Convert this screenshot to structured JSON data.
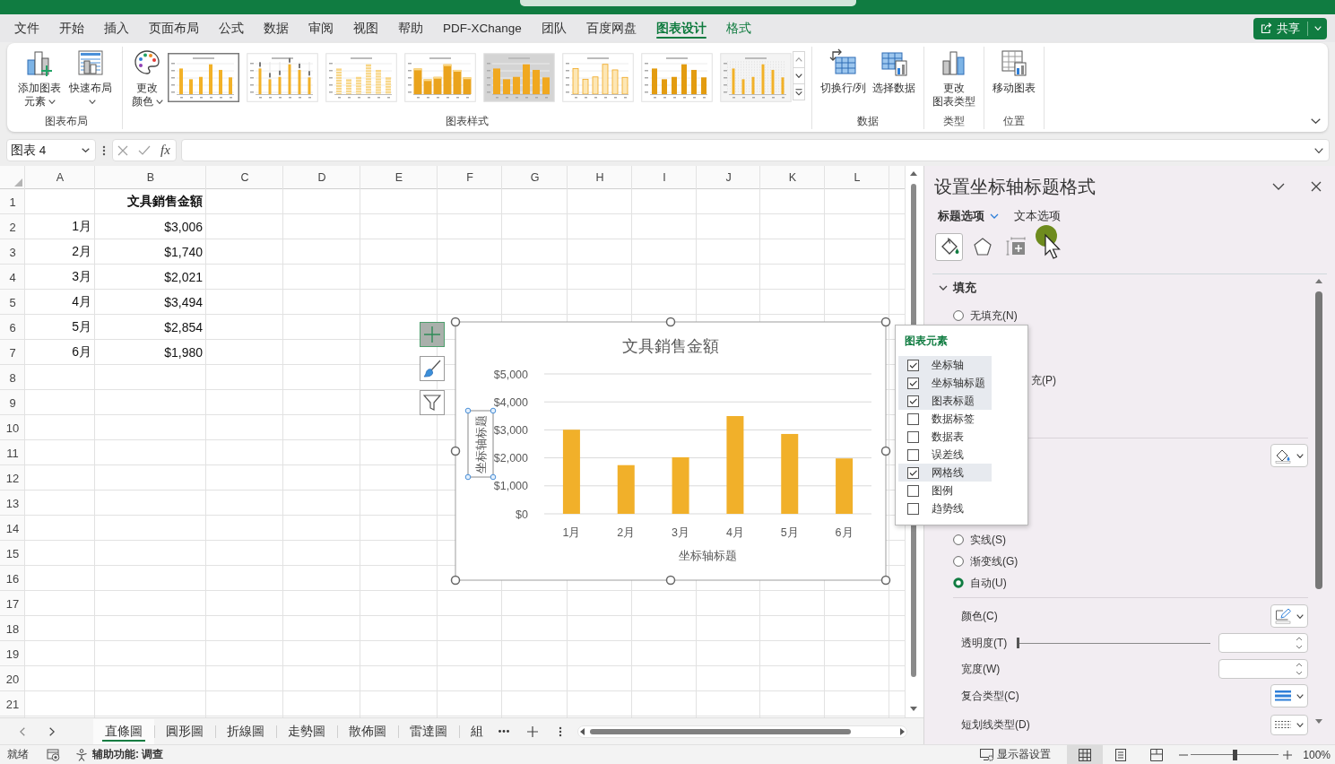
{
  "menu_tabs": [
    {
      "label": "文件",
      "kind": "standard",
      "selected": false
    },
    {
      "label": "开始",
      "kind": "standard",
      "selected": false
    },
    {
      "label": "插入",
      "kind": "standard",
      "selected": false
    },
    {
      "label": "页面布局",
      "kind": "standard",
      "selected": false
    },
    {
      "label": "公式",
      "kind": "standard",
      "selected": false
    },
    {
      "label": "数据",
      "kind": "standard",
      "selected": false
    },
    {
      "label": "审阅",
      "kind": "standard",
      "selected": false
    },
    {
      "label": "视图",
      "kind": "standard",
      "selected": false
    },
    {
      "label": "帮助",
      "kind": "standard",
      "selected": false
    },
    {
      "label": "PDF-XChange",
      "kind": "standard",
      "selected": false
    },
    {
      "label": "团队",
      "kind": "standard",
      "selected": false
    },
    {
      "label": "百度网盘",
      "kind": "standard",
      "selected": false
    },
    {
      "label": "图表设计",
      "kind": "contextual",
      "selected": true
    },
    {
      "label": "格式",
      "kind": "contextual",
      "selected": false
    }
  ],
  "share_button": {
    "label": "共享"
  },
  "ribbon": {
    "groups": [
      {
        "label": "图表布局",
        "buttons": [
          {
            "kind": "add_element",
            "label": "添加图表元素",
            "dropdown": true
          },
          {
            "kind": "quick_layout",
            "label": "快速布局",
            "dropdown": true
          }
        ]
      },
      {
        "label": "图表样式",
        "buttons": [
          {
            "kind": "colors",
            "label": "更改颜色",
            "dropdown": true
          }
        ],
        "gallery": [
          {
            "kind": "plain",
            "selected": true
          },
          {
            "kind": "labels",
            "selected": false
          },
          {
            "kind": "striped",
            "selected": false
          },
          {
            "kind": "gradient",
            "selected": false
          },
          {
            "kind": "dark",
            "selected": false
          },
          {
            "kind": "outline",
            "selected": false
          },
          {
            "kind": "dark_bars",
            "selected": false
          },
          {
            "kind": "pattern",
            "selected": false
          }
        ]
      },
      {
        "label": "数据",
        "buttons": [
          {
            "kind": "switch",
            "label": "切换行/列"
          },
          {
            "kind": "select_data",
            "label": "选择数据"
          }
        ]
      },
      {
        "label": "类型",
        "buttons": [
          {
            "kind": "change_type",
            "label": "更改图表类型"
          }
        ]
      },
      {
        "label": "位置",
        "buttons": [
          {
            "kind": "move",
            "label": "移动图表"
          }
        ]
      }
    ]
  },
  "formula_bar": {
    "name_box": "图表 4",
    "function_button": "fx"
  },
  "sheet": {
    "column_headers": [
      "A",
      "B",
      "C",
      "D",
      "E",
      "F",
      "G",
      "H",
      "I",
      "J",
      "K",
      "L"
    ],
    "rows": [
      {
        "number": "1",
        "kind": "header",
        "cells": [
          null,
          "文具銷售金額"
        ]
      },
      {
        "number": "2",
        "kind": "data",
        "cells": [
          "1月",
          "$3,006"
        ]
      },
      {
        "number": "3",
        "kind": "data",
        "cells": [
          "2月",
          "$1,740"
        ]
      },
      {
        "number": "4",
        "kind": "data",
        "cells": [
          "3月",
          "$2,021"
        ]
      },
      {
        "number": "5",
        "kind": "data",
        "cells": [
          "4月",
          "$3,494"
        ]
      },
      {
        "number": "6",
        "kind": "data",
        "cells": [
          "5月",
          "$2,854"
        ]
      },
      {
        "number": "7",
        "kind": "data",
        "cells": [
          "6月",
          "$1,980"
        ]
      },
      {
        "number": "8",
        "kind": "empty"
      },
      {
        "number": "9",
        "kind": "empty"
      },
      {
        "number": "10",
        "kind": "empty"
      },
      {
        "number": "11",
        "kind": "empty"
      },
      {
        "number": "12",
        "kind": "empty"
      },
      {
        "number": "13",
        "kind": "empty"
      },
      {
        "number": "14",
        "kind": "empty"
      },
      {
        "number": "15",
        "kind": "empty"
      },
      {
        "number": "16",
        "kind": "empty"
      },
      {
        "number": "17",
        "kind": "empty"
      },
      {
        "number": "18",
        "kind": "empty"
      },
      {
        "number": "19",
        "kind": "empty"
      },
      {
        "number": "20",
        "kind": "empty"
      },
      {
        "number": "21",
        "kind": "empty"
      }
    ]
  },
  "chart": {
    "selected": true,
    "ylabel_selected": true,
    "chart_data": {
      "type": "bar",
      "title": "文具銷售金額",
      "xlabel": "坐标轴标题",
      "ylabel": "坐标轴标题",
      "categories": [
        "1月",
        "2月",
        "3月",
        "4月",
        "5月",
        "6月"
      ],
      "values": [
        3006,
        1740,
        2021,
        3494,
        2854,
        1980
      ],
      "ylim": [
        0,
        5000
      ],
      "yticks": [
        {
          "value": 0,
          "label": "$0"
        },
        {
          "value": 1000,
          "label": "$1,000"
        },
        {
          "value": 2000,
          "label": "$2,000"
        },
        {
          "value": 3000,
          "label": "$3,000"
        },
        {
          "value": 4000,
          "label": "$4,000"
        },
        {
          "value": 5000,
          "label": "$5,000"
        }
      ],
      "grid": true
    }
  },
  "chart_buttons": [
    {
      "kind": "elements",
      "selected": true
    },
    {
      "kind": "styles",
      "selected": false
    },
    {
      "kind": "filters",
      "selected": false
    }
  ],
  "elements_popup": {
    "title": "图表元素",
    "items": [
      {
        "label": "坐标轴",
        "checked": true
      },
      {
        "label": "坐标轴标题",
        "checked": true
      },
      {
        "label": "图表标题",
        "checked": true
      },
      {
        "label": "数据标签",
        "checked": false
      },
      {
        "label": "数据表",
        "checked": false
      },
      {
        "label": "误差线",
        "checked": false
      },
      {
        "label": "网格线",
        "checked": true
      },
      {
        "label": "图例",
        "checked": false
      },
      {
        "label": "趋势线",
        "checked": false
      }
    ]
  },
  "format_pane": {
    "title": "设置坐标轴标题格式",
    "tabs": [
      {
        "label": "标题选项",
        "selected": true
      },
      {
        "label": "文本选项",
        "selected": false
      }
    ],
    "icon_tabs": [
      {
        "kind": "fill_line",
        "selected": true
      },
      {
        "kind": "effects",
        "selected": false
      },
      {
        "kind": "size_properties",
        "selected": false
      }
    ],
    "section": {
      "label": "填充",
      "expanded": true
    },
    "rows": [
      {
        "kind": "radio",
        "label": "无填充(N)",
        "selected": false
      },
      {
        "kind": "fragment",
        "label": "充(P)"
      },
      {
        "kind": "divider"
      },
      {
        "kind": "fill_color"
      },
      {
        "kind": "radio",
        "label": "实线(S)",
        "selected": false
      },
      {
        "kind": "radio",
        "label": "渐变线(G)",
        "selected": false
      },
      {
        "kind": "radio",
        "label": "自动(U)",
        "selected": true
      },
      {
        "kind": "divider"
      },
      {
        "kind": "color",
        "label": "颜色(C)"
      },
      {
        "kind": "slider",
        "label": "透明度(T)",
        "level": 0
      },
      {
        "kind": "spin",
        "label": "宽度(W)"
      },
      {
        "kind": "compound",
        "label": "复合类型(C)"
      },
      {
        "kind": "dash",
        "label": "短划线类型(D)"
      }
    ]
  },
  "sheet_tabs": [
    {
      "label": "直條圖",
      "selected": true
    },
    {
      "label": "圓形圖",
      "selected": false
    },
    {
      "label": "折線圖",
      "selected": false
    },
    {
      "label": "走勢圖",
      "selected": false
    },
    {
      "label": "散佈圖",
      "selected": false
    },
    {
      "label": "雷達圖",
      "selected": false
    },
    {
      "label": "組",
      "selected": false
    }
  ],
  "status_bar": {
    "ready": "就绪",
    "accessibility": "辅助功能: 调查",
    "display_settings": "显示器设置",
    "views": [
      {
        "kind": "normal",
        "selected": true
      },
      {
        "kind": "page_layout",
        "selected": false
      },
      {
        "kind": "page_break",
        "selected": false
      }
    ],
    "zoom": {
      "level": 0.5,
      "reading": "100%"
    }
  }
}
